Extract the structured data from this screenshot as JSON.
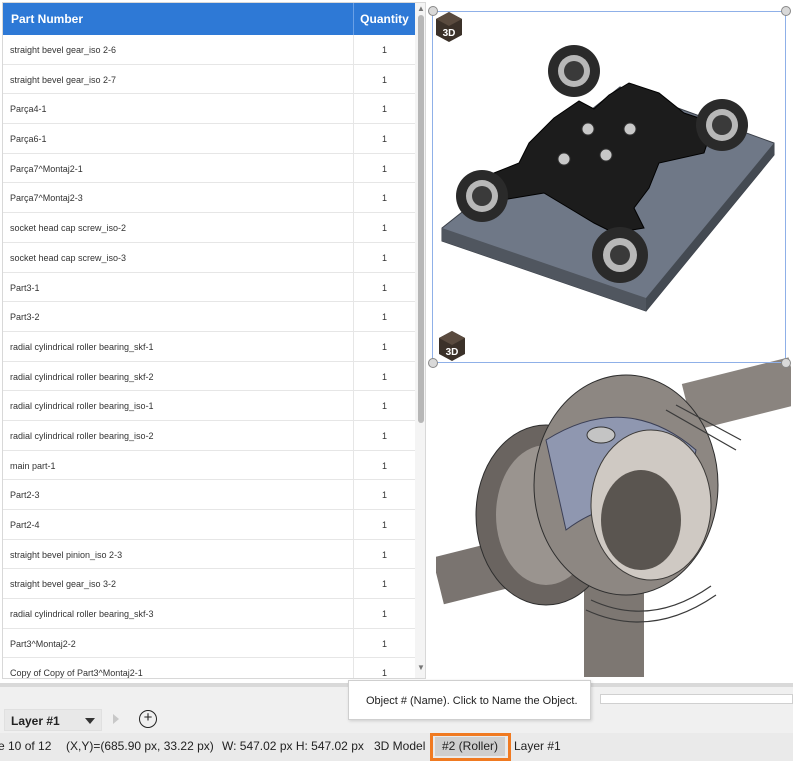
{
  "table": {
    "header_part": "Part Number",
    "header_qty": "Quantity",
    "rows": [
      {
        "part": "straight bevel gear_iso 2-6",
        "qty": "1"
      },
      {
        "part": "straight bevel gear_iso 2-7",
        "qty": "1"
      },
      {
        "part": "Parça4-1",
        "qty": "1"
      },
      {
        "part": "Parça6-1",
        "qty": "1"
      },
      {
        "part": "Parça7^Montaj2-1",
        "qty": "1"
      },
      {
        "part": "Parça7^Montaj2-3",
        "qty": "1"
      },
      {
        "part": "socket head cap screw_iso-2",
        "qty": "1"
      },
      {
        "part": "socket head cap screw_iso-3",
        "qty": "1"
      },
      {
        "part": "Part3-1",
        "qty": "1"
      },
      {
        "part": "Part3-2",
        "qty": "1"
      },
      {
        "part": "radial cylindrical roller bearing_skf-1",
        "qty": "1"
      },
      {
        "part": "radial cylindrical roller bearing_skf-2",
        "qty": "1"
      },
      {
        "part": "radial cylindrical roller bearing_iso-1",
        "qty": "1"
      },
      {
        "part": "radial cylindrical roller bearing_iso-2",
        "qty": "1"
      },
      {
        "part": "main part-1",
        "qty": "1"
      },
      {
        "part": "Part2-3",
        "qty": "1"
      },
      {
        "part": "Part2-4",
        "qty": "1"
      },
      {
        "part": "straight bevel pinion_iso 2-3",
        "qty": "1"
      },
      {
        "part": "straight bevel gear_iso 3-2",
        "qty": "1"
      },
      {
        "part": "radial cylindrical roller bearing_skf-3",
        "qty": "1"
      },
      {
        "part": "Part3^Montaj2-2",
        "qty": "1"
      },
      {
        "part": "Copy of Copy of Part3^Montaj2-1",
        "qty": "1"
      }
    ]
  },
  "badges": {
    "model_badge": "3D"
  },
  "layer_bar": {
    "layer_select": "Layer #1"
  },
  "tooltip": {
    "text": "Object # (Name). Click to Name the Object."
  },
  "status": {
    "page": "e 10 of 12",
    "coords": "(X,Y)=(685.90 px, 33.22 px)",
    "size": "W: 547.02 px H: 547.02 px",
    "type": "3D Model",
    "object": "#2 (Roller)",
    "layer": "Layer #1"
  },
  "colors": {
    "header": "#2e79d6",
    "highlight": "#f07a21",
    "selection": "#8fb0e8"
  }
}
